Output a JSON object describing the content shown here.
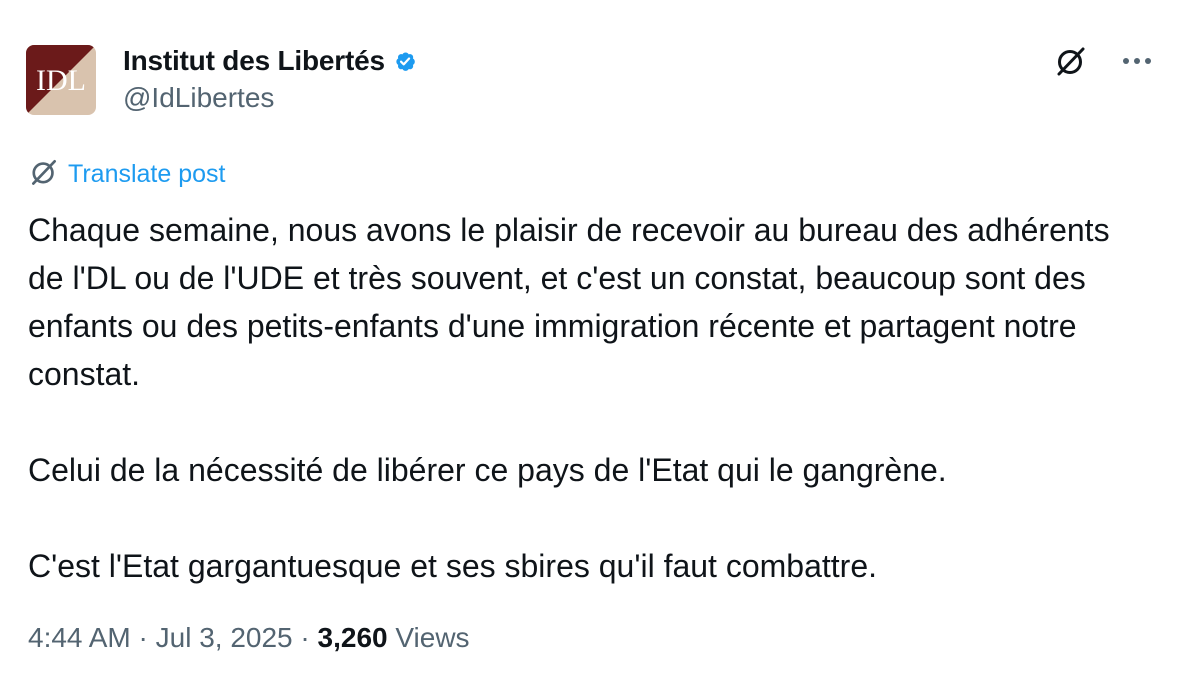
{
  "author": {
    "avatar_text": "IDL",
    "display_name": "Institut des Libertés",
    "handle": "@IdLibertes",
    "verified_icon": "verified-badge-icon"
  },
  "actions": {
    "grok_icon": "grok-icon",
    "more_icon": "more-options-icon"
  },
  "translate": {
    "icon": "grok-icon",
    "label": "Translate post"
  },
  "post": {
    "paragraphs": [
      "Chaque semaine, nous avons le plaisir de recevoir au bureau des adhérents de l'DL ou de l'UDE et très souvent, et c'est un constat, beaucoup sont des enfants ou des petits-enfants d'une immigration récente et partagent notre constat.",
      "Celui de la nécessité de libérer ce pays de l'Etat qui le gangrène.",
      "C'est l'Etat gargantuesque et ses sbires qu'il faut combattre."
    ]
  },
  "meta": {
    "time": "4:44 AM",
    "separator": " · ",
    "date": "Jul 3, 2025",
    "views_count": "3,260",
    "views_label": " Views"
  },
  "colors": {
    "text": "#0f1419",
    "secondary": "#536471",
    "accent": "#1d9bf0",
    "avatar_dark": "#6b1a1a",
    "avatar_light": "#d9c3ae"
  }
}
